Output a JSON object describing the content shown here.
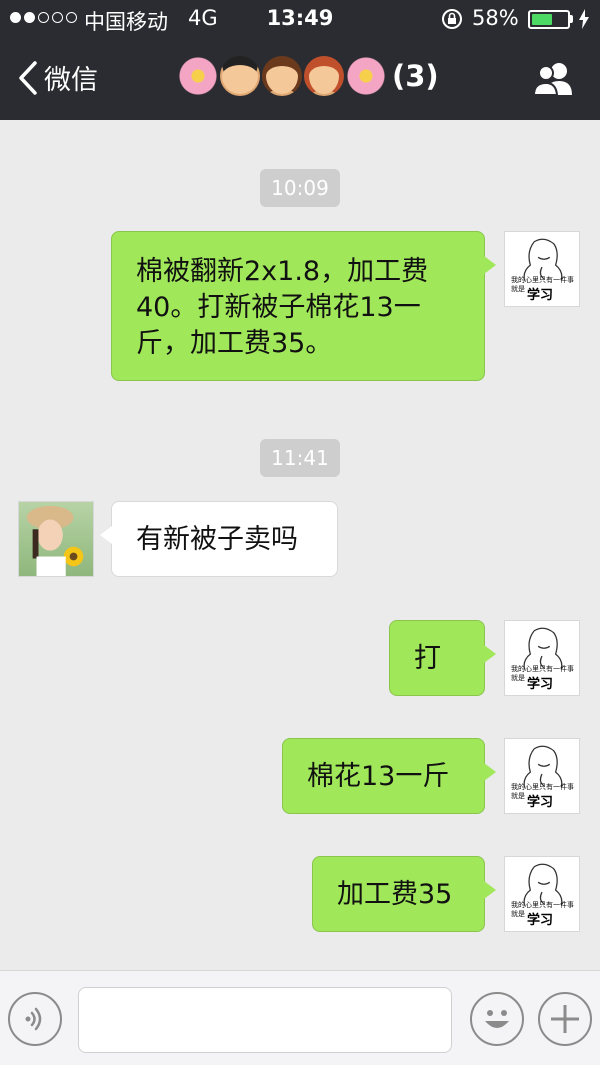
{
  "status_bar": {
    "carrier": "中国移动",
    "network": "4G",
    "time": "13:49",
    "battery_percent": "58%",
    "battery_level": 0.58,
    "signal_bars_filled": 2,
    "signal_bars_total": 5
  },
  "nav": {
    "back_label": "微信",
    "title_count": "(3)"
  },
  "messages": [
    {
      "type": "timestamp",
      "text": "10:09"
    },
    {
      "type": "outgoing",
      "lines": [
        "棉被翻新2x1.8，加工费",
        "40。打新被子棉花13一",
        "斤，加工费35。"
      ]
    },
    {
      "type": "timestamp",
      "text": "11:41"
    },
    {
      "type": "incoming",
      "text": "有新被子卖吗"
    },
    {
      "type": "outgoing",
      "text": "打"
    },
    {
      "type": "outgoing",
      "text": "棉花13一斤"
    },
    {
      "type": "outgoing",
      "text": "加工费35"
    }
  ],
  "sticker": {
    "small_text": "我的心里只有一件事 就是",
    "big_text": "学习"
  },
  "input_bar": {
    "text_value": ""
  },
  "colors": {
    "nav_bg": "#2b2c31",
    "chat_bg": "#ebebeb",
    "outgoing_bubble": "#a0e75a",
    "incoming_bubble": "#ffffff",
    "timestamp_bg": "#cecece",
    "battery_fill": "#4cd964"
  }
}
